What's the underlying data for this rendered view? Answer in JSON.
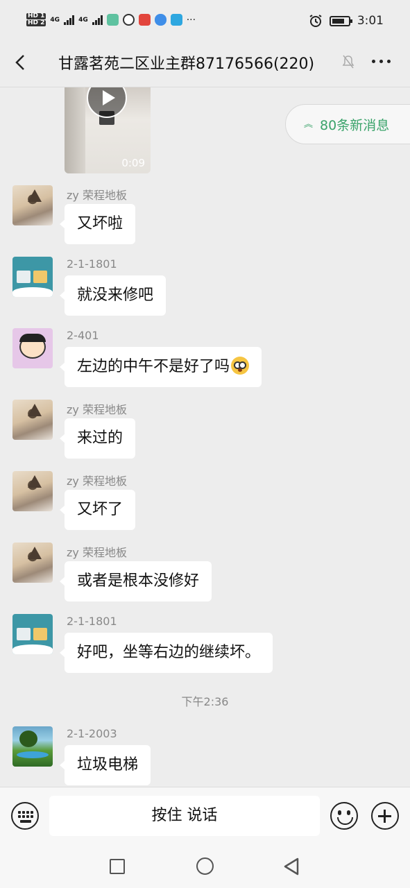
{
  "status_bar": {
    "sim1": "HD 1",
    "sim2": "HD 2",
    "network1": "4G",
    "network2": "4G",
    "overflow": "···",
    "time": "3:01"
  },
  "header": {
    "title": "甘露茗苑二区业主群87176566(220)"
  },
  "new_messages": {
    "label": "80条新消息",
    "accent": "#3aa36a"
  },
  "video": {
    "duration": "0:09"
  },
  "messages": [
    {
      "sender": "zy 荣程地板",
      "text": "又坏啦"
    },
    {
      "sender": "2-1-1801",
      "text": "就没来修吧"
    },
    {
      "sender": "2-401",
      "text": "左边的中午不是好了吗",
      "emoji": "flushed-face"
    },
    {
      "sender": "zy 荣程地板",
      "text": "来过的"
    },
    {
      "sender": "zy 荣程地板",
      "text": "又坏了"
    },
    {
      "sender": "zy 荣程地板",
      "text": "或者是根本没修好"
    },
    {
      "sender": "2-1-1801",
      "text": "好吧，坐等右边的继续坏。"
    },
    {
      "sender": "2-1-2003",
      "text": "垃圾电梯"
    }
  ],
  "timestamp": "下午2:36",
  "input_bar": {
    "talk_label": "按住 说话"
  }
}
